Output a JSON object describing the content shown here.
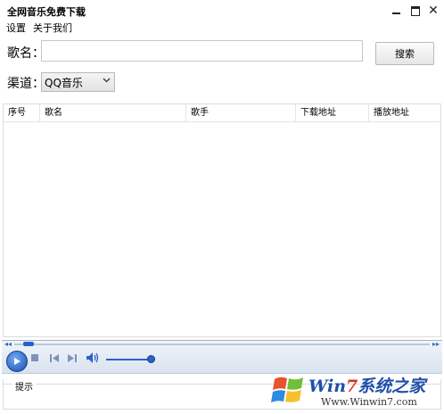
{
  "window": {
    "title": "全网音乐免费下载",
    "min": "minimize",
    "max": "maximize",
    "close": "close"
  },
  "menu": {
    "settings": "设置",
    "about": "关于我们"
  },
  "search": {
    "label": "歌名：",
    "value": "",
    "button": "搜索"
  },
  "channel": {
    "label": "渠道：",
    "selected": "QQ音乐"
  },
  "table": {
    "columns": [
      "序号",
      "歌名",
      "歌手",
      "下载地址",
      "播放地址"
    ]
  },
  "player": {
    "play_icon": "play-icon",
    "stop_icon": "stop-icon",
    "prev_icon": "previous-icon",
    "next_icon": "next-icon",
    "volume_icon": "volume-icon"
  },
  "status": {
    "label": "提示"
  },
  "watermark": {
    "text": "Win7系统之家",
    "url": "Www.Winwin7.com"
  }
}
